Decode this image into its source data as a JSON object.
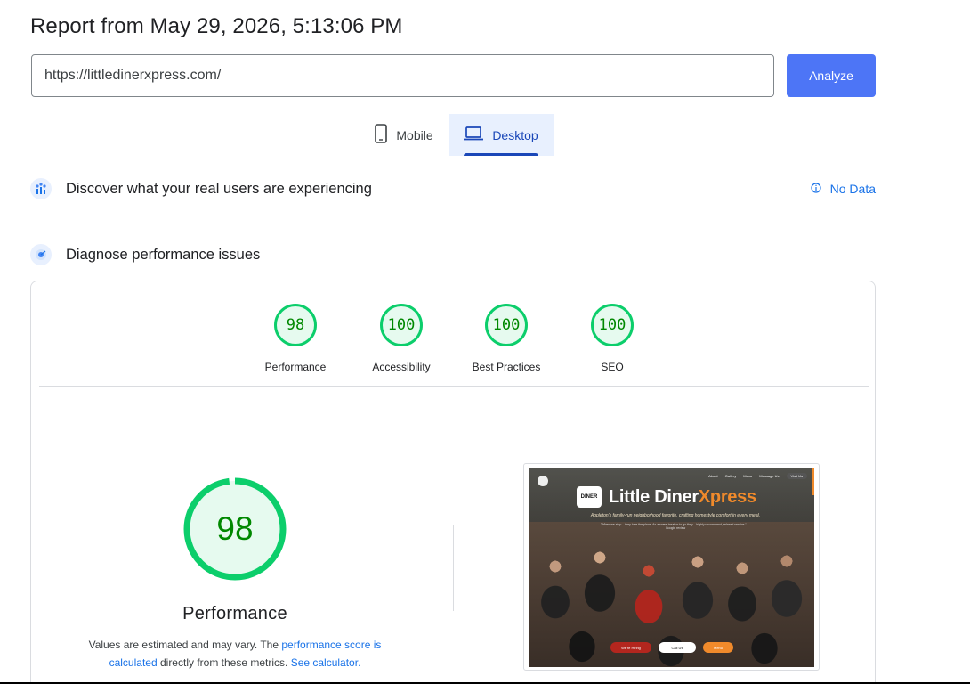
{
  "report": {
    "title": "Report from May 29, 2026, 5:13:06 PM"
  },
  "search": {
    "url_value": "https://littledinerxpress.com/",
    "analyze_label": "Analyze"
  },
  "tabs": [
    {
      "label": "Mobile",
      "icon": "phone-icon",
      "selected": false
    },
    {
      "label": "Desktop",
      "icon": "laptop-icon",
      "selected": true
    }
  ],
  "sections": {
    "real_users": {
      "title": "Discover what your real users are experiencing",
      "status": "No Data",
      "icon": "crux-users-icon"
    },
    "diagnose": {
      "title": "Diagnose performance issues",
      "icon": "lighthouse-icon"
    }
  },
  "scores": [
    {
      "label": "Performance",
      "value": "98"
    },
    {
      "label": "Accessibility",
      "value": "100"
    },
    {
      "label": "Best Practices",
      "value": "100"
    },
    {
      "label": "SEO",
      "value": "100"
    }
  ],
  "performance": {
    "score": "98",
    "score_fraction": 0.98,
    "label": "Performance",
    "note_prefix": "Values are estimated and may vary. The ",
    "note_link1": "performance score is calculated",
    "note_middle": " directly from these metrics. ",
    "note_link2": "See calculator."
  },
  "screenshot": {
    "brand_main": "Little Diner",
    "brand_accent": "Xpress",
    "tagline": "Appleton's family-run neighborhood favorite, crafting homestyle comfort in every meal.",
    "nav": [
      "About",
      "Gallery",
      "Menu",
      "Message Us",
      "Visit Us"
    ],
    "logo_text": "DINER",
    "quote": "\"When we stop... they love the place. As a sweet treat or to go they... highly recommend, relaxed service.\" — Google review",
    "cta": [
      "We're Hiring",
      "Call Us",
      "Menu"
    ]
  },
  "colors": {
    "pass_green": "#0cce6b",
    "pass_text": "#008800",
    "link_blue": "#1a73e8",
    "accent_blue": "#4d75f6"
  }
}
